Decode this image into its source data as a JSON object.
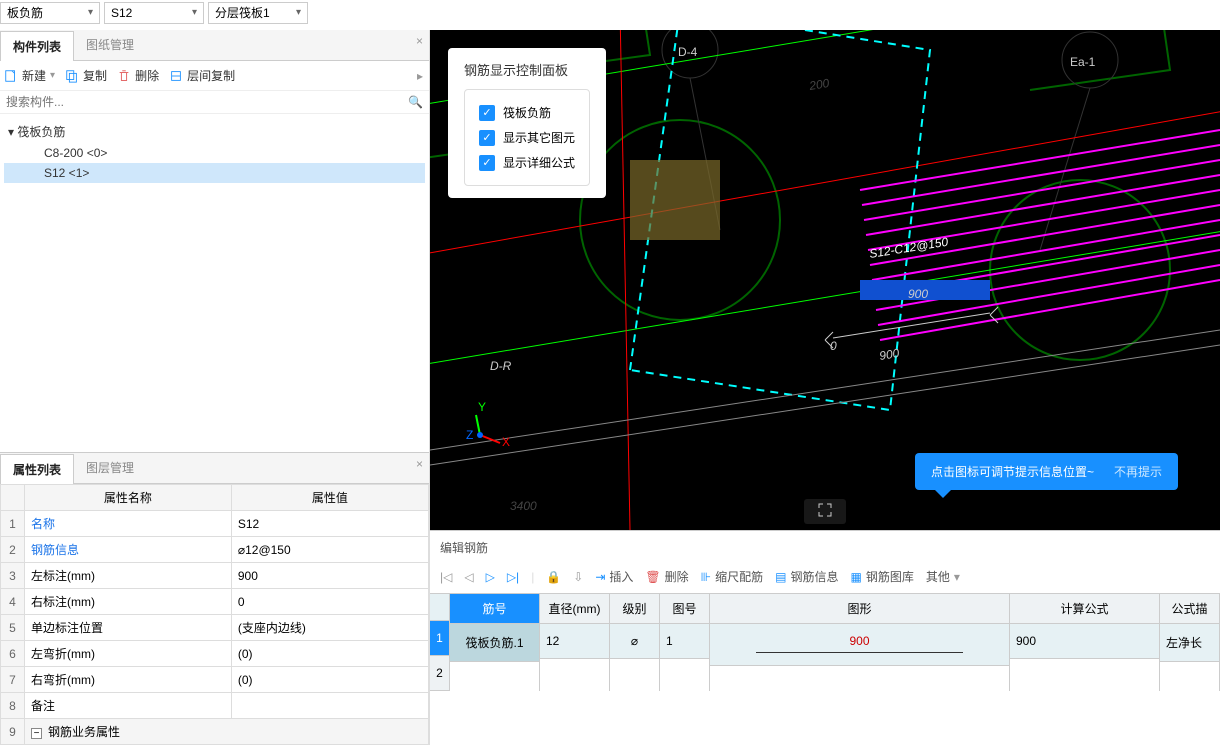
{
  "dropdowns": {
    "d1": "板负筋",
    "d2": "S12",
    "d3": "分层筏板1"
  },
  "leftTabs": {
    "components": "构件列表",
    "drawings": "图纸管理"
  },
  "toolbar": {
    "newLabel": "新建",
    "copyLabel": "复制",
    "deleteLabel": "删除",
    "floorCopyLabel": "层间复制"
  },
  "searchPlaceholder": "搜索构件...",
  "tree": {
    "root": "筏板负筋",
    "c1": "C8-200 <0>",
    "c2": "S12 <1>"
  },
  "propTabs": {
    "props": "属性列表",
    "layers": "图层管理"
  },
  "propHeaders": {
    "name": "属性名称",
    "value": "属性值"
  },
  "propRows": {
    "r1": {
      "num": "1",
      "name": "名称",
      "value": "S12"
    },
    "r2": {
      "num": "2",
      "name": "钢筋信息",
      "value": "⌀12@150"
    },
    "r3": {
      "num": "3",
      "name": "左标注(mm)",
      "value": "900"
    },
    "r4": {
      "num": "4",
      "name": "右标注(mm)",
      "value": "0"
    },
    "r5": {
      "num": "5",
      "name": "单边标注位置",
      "value": "(支座内边线)"
    },
    "r6": {
      "num": "6",
      "name": "左弯折(mm)",
      "value": "(0)"
    },
    "r7": {
      "num": "7",
      "name": "右弯折(mm)",
      "value": "(0)"
    },
    "r8": {
      "num": "8",
      "name": "备注",
      "value": ""
    },
    "r9": {
      "num": "9",
      "name": "钢筋业务属性",
      "value": ""
    }
  },
  "controlPanel": {
    "title": "钢筋显示控制面板",
    "c1": "筏板负筋",
    "c2": "显示其它图元",
    "c3": "显示详细公式"
  },
  "viewportLabels": {
    "d4": "D-4",
    "ea1": "Ea-1",
    "dr": "D-R",
    "s12": "S12-C12@150",
    "n200": "200",
    "n0": "0",
    "n900a": "900",
    "n900b": "900",
    "n3400": "3400"
  },
  "tip": {
    "text": "点击图标可调节提示信息位置~",
    "dismiss": "不再提示"
  },
  "editor": {
    "title": "编辑钢筋",
    "btns": {
      "insert": "插入",
      "delete": "删除",
      "scale": "缩尺配筋",
      "info": "钢筋信息",
      "lib": "钢筋图库",
      "other": "其他"
    },
    "headers": {
      "no": "筋号",
      "dia": "直径(mm)",
      "grade": "级别",
      "fig": "图号",
      "shape": "图形",
      "formula": "计算公式",
      "desc": "公式描"
    },
    "row1": {
      "idx": "1",
      "no": "筏板负筋.1",
      "dia": "12",
      "grade": "⌀",
      "fig": "1",
      "shape": "900",
      "formula": "900",
      "desc": "左净长"
    },
    "row2": {
      "idx": "2"
    }
  }
}
